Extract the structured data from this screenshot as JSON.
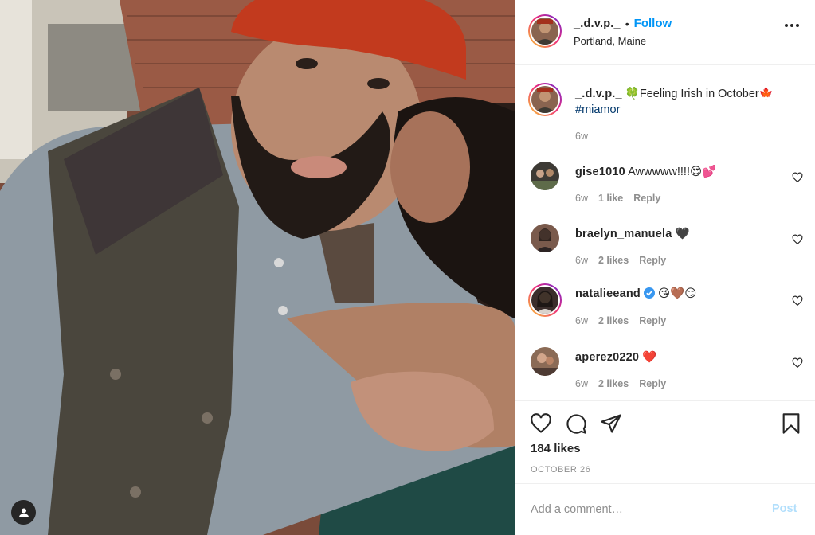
{
  "post": {
    "author": "_.d.v.p._",
    "follow_label": "Follow",
    "separator": "•",
    "location": "Portland, Maine",
    "more_icon": "more-horizontal-icon",
    "caption_prefix": "🍀Feeling Irish in October🍁",
    "hashtag": "#miamor",
    "caption_age": "6w",
    "likes": "184 likes",
    "date": "OCTOBER 26",
    "add_comment_placeholder": "Add a comment…",
    "post_label": "Post"
  },
  "comments": [
    {
      "user": "gise1010",
      "text": "Awwwww!!!!😍💕",
      "age": "6w",
      "likes": "1 like",
      "reply": "Reply",
      "avatar_color": "#3d3a35"
    },
    {
      "user": "braelyn_manuela",
      "text": "🖤",
      "age": "6w",
      "likes": "2 likes",
      "reply": "Reply",
      "avatar_color": "#7a5a4c"
    },
    {
      "user": "natalieeand",
      "text": "😘🤎😏",
      "age": "6w",
      "likes": "2 likes",
      "reply": "Reply",
      "avatar_color": "#3b2e2c",
      "verified": true,
      "story_ring": true
    },
    {
      "user": "aperez0220",
      "text": "❤️",
      "age": "6w",
      "likes": "2 likes",
      "reply": "Reply",
      "avatar_color": "#8b6b56"
    }
  ],
  "colors": {
    "link_blue": "#0095f6",
    "hashtag_blue": "#00376b",
    "secondary_text": "#8e8e8e",
    "post_disabled": "#b2dffc",
    "verified": "#3897f0"
  },
  "icons": [
    "heart-icon",
    "comment-icon",
    "share-icon",
    "bookmark-icon",
    "user-tag-icon",
    "verified-badge-icon"
  ]
}
